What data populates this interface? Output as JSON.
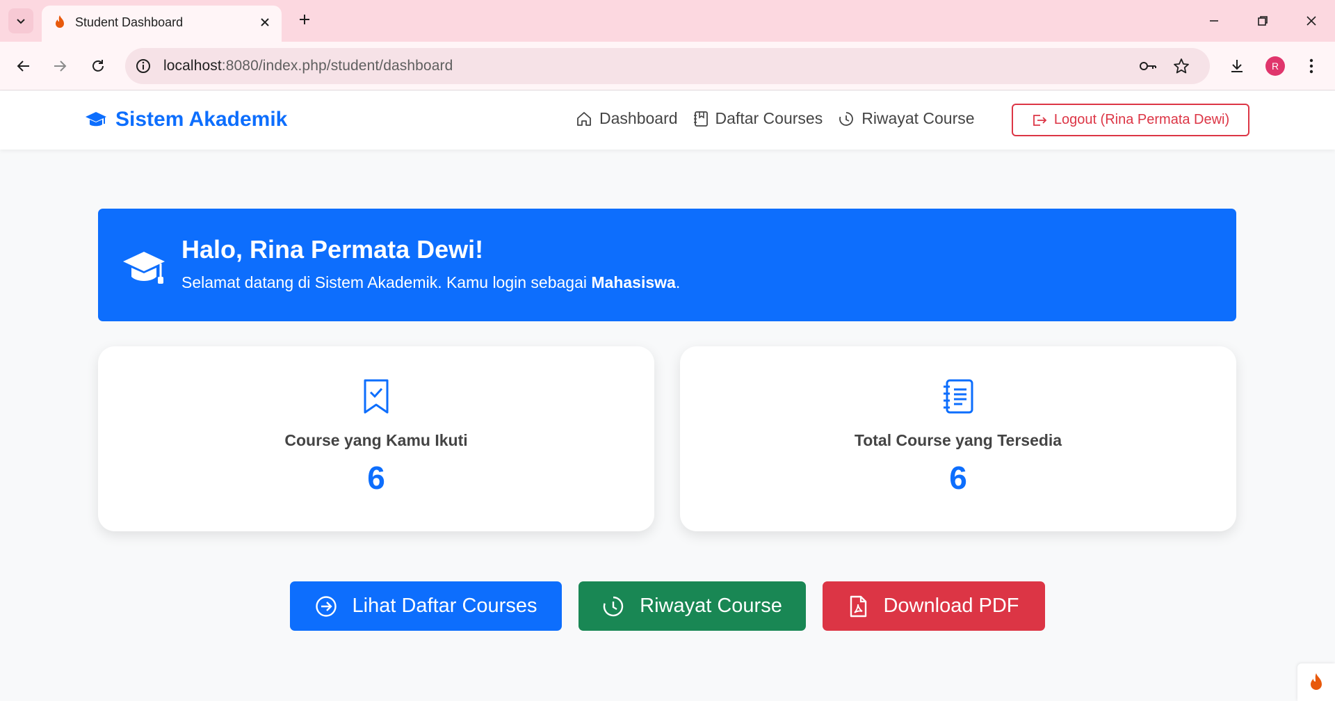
{
  "browser": {
    "tab_title": "Student Dashboard",
    "url_host": "localhost",
    "url_path": ":8080/index.php/student/dashboard",
    "profile_initial": "R"
  },
  "navbar": {
    "brand": "Sistem Akademik",
    "links": [
      {
        "label": "Dashboard",
        "icon": "house-icon"
      },
      {
        "label": "Daftar Courses",
        "icon": "journal-bookmark-icon"
      },
      {
        "label": "Riwayat Course",
        "icon": "clock-history-icon"
      }
    ],
    "logout_label": "Logout (Rina Permata Dewi)"
  },
  "welcome": {
    "title": "Halo, Rina Permata Dewi!",
    "subtitle_prefix": "Selamat datang di Sistem Akademik. Kamu login sebagai ",
    "role": "Mahasiswa",
    "subtitle_suffix": "."
  },
  "stats": [
    {
      "label": "Course yang Kamu Ikuti",
      "value": "6",
      "icon": "bookmark-check-icon"
    },
    {
      "label": "Total Course yang Tersedia",
      "value": "6",
      "icon": "journal-text-icon"
    }
  ],
  "actions": {
    "courses": "Lihat Daftar Courses",
    "history": "Riwayat Course",
    "pdf": "Download PDF"
  },
  "colors": {
    "primary": "#0d6efd",
    "success": "#198754",
    "danger": "#dc3545",
    "tabbar": "#fcd8e0"
  }
}
